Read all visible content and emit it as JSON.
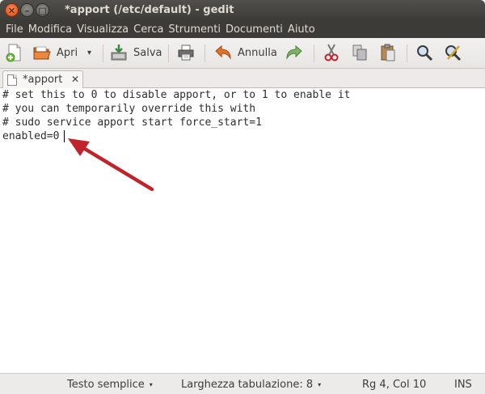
{
  "window": {
    "title": "*apport (/etc/default) - gedit",
    "close_glyph": "✕",
    "min_glyph": "–",
    "max_glyph": "□"
  },
  "menubar": {
    "items": [
      "File",
      "Modifica",
      "Visualizza",
      "Cerca",
      "Strumenti",
      "Documenti",
      "Aiuto"
    ]
  },
  "toolbar": {
    "open_label": "Apri",
    "save_label": "Salva",
    "undo_label": "Annulla",
    "dropdown_glyph": "▾",
    "icons": [
      "new-document-icon",
      "open-folder-icon",
      "save-icon",
      "print-icon",
      "undo-icon",
      "redo-icon",
      "cut-icon",
      "copy-icon",
      "paste-icon",
      "search-icon",
      "replace-icon"
    ]
  },
  "tab": {
    "label": "*apport",
    "close_glyph": "✕"
  },
  "editor": {
    "lines": [
      "# set this to 0 to disable apport, or to 1 to enable it",
      "# you can temporarily override this with",
      "# sudo service apport start force_start=1",
      "enabled=0"
    ]
  },
  "statusbar": {
    "language": "Testo semplice",
    "tab_width": "Larghezza tabulazione: 8",
    "position": "Rg 4, Col 10",
    "mode": "INS",
    "dropdown_glyph": "▾"
  },
  "annotation": {
    "arrow_color": "#c0242a"
  }
}
